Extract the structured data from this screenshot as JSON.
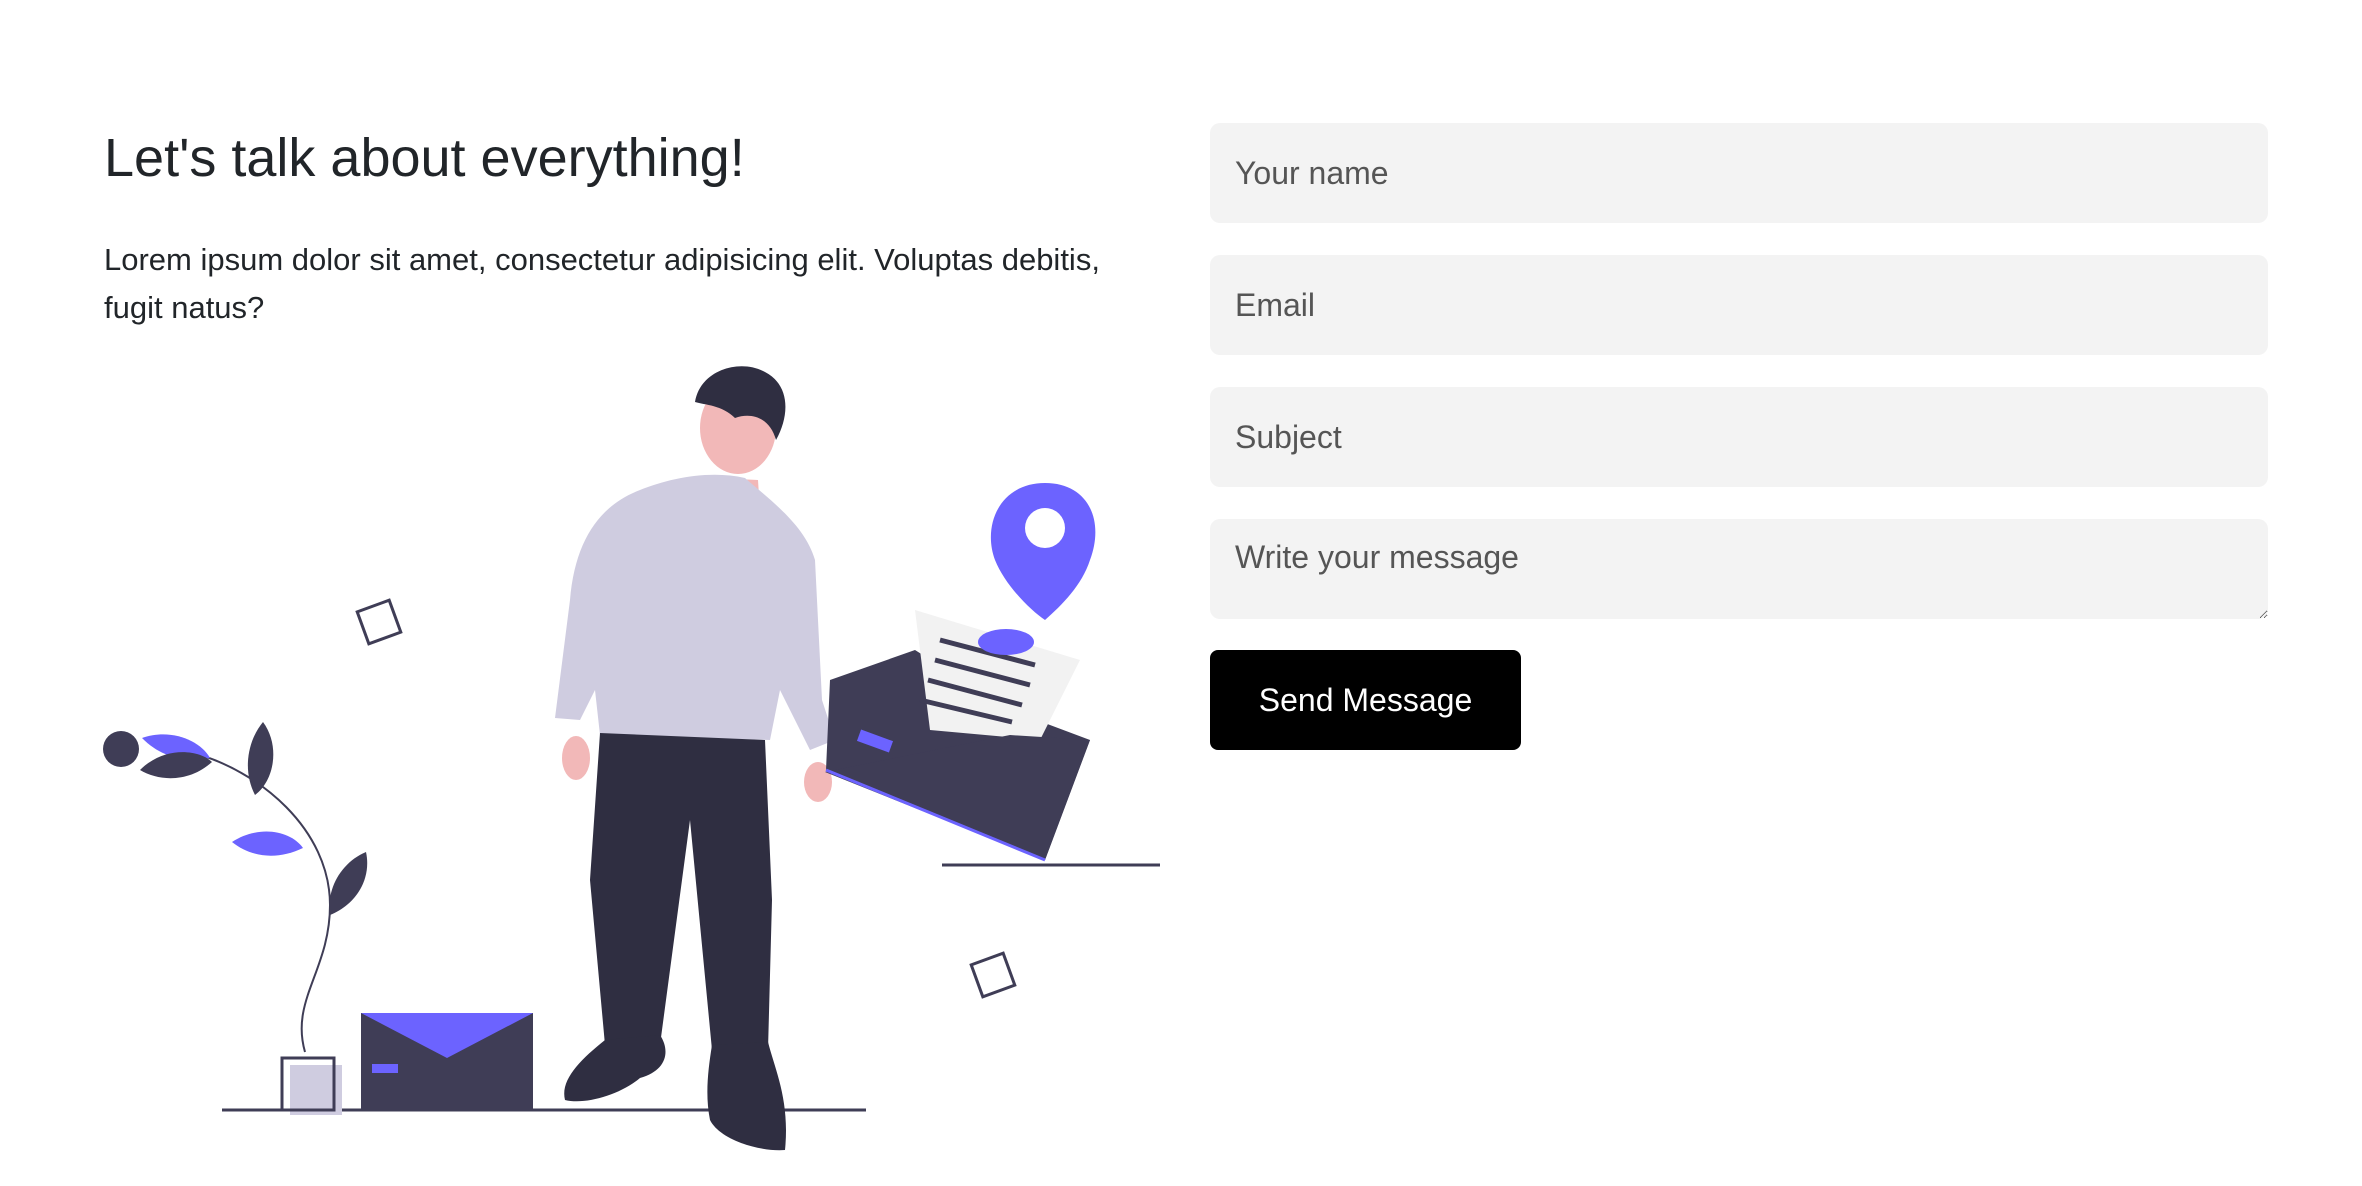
{
  "contact": {
    "title": "Let's talk about everything!",
    "intro": "Lorem ipsum dolor sit amet, consectetur adipisicing elit. Voluptas debitis, fugit natus?"
  },
  "form": {
    "name_placeholder": "Your name",
    "email_placeholder": "Email",
    "subject_placeholder": "Subject",
    "message_placeholder": "Write your message",
    "submit_label": "Send Message"
  },
  "illustration": {
    "subject": "person holding envelope with location pin",
    "icons": [
      "location-pin-icon",
      "envelope-icon",
      "plant-icon"
    ]
  },
  "colors": {
    "accent": "#6c63ff",
    "dark": "#3f3d56",
    "pants": "#2f2e41",
    "shirt": "#cfcce0",
    "skin": "#f2b8b8",
    "field_bg": "#f3f3f3",
    "button_bg": "#000000",
    "button_text": "#ffffff"
  }
}
